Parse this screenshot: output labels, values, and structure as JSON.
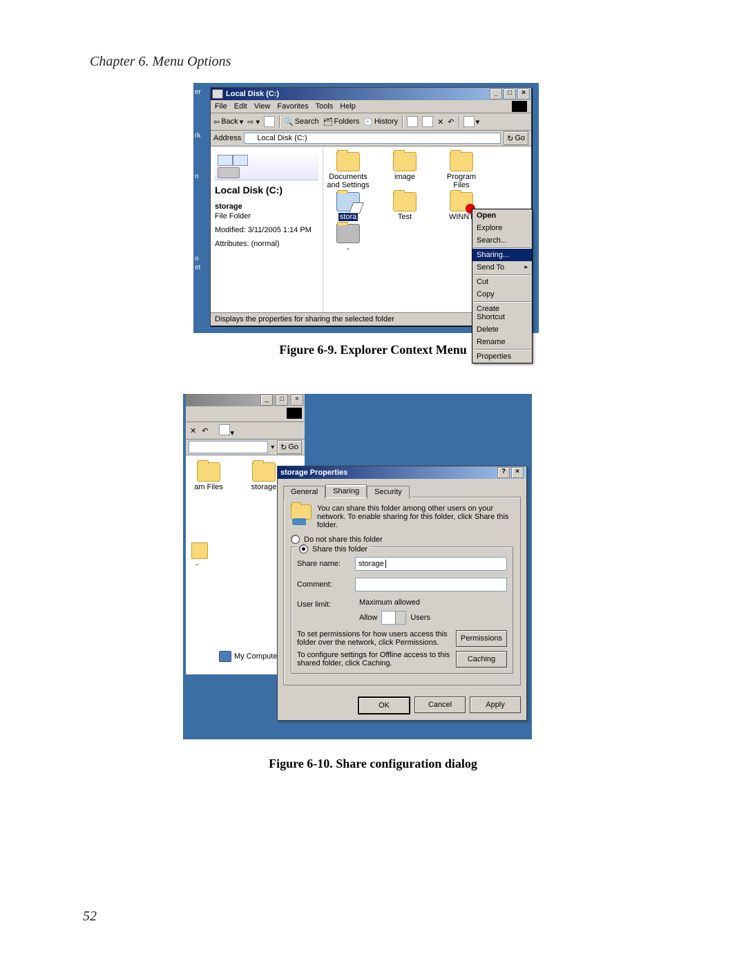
{
  "page": {
    "chapter_heading": "Chapter 6. Menu Options",
    "caption1": "Figure 6-9. Explorer Context Menu",
    "caption2": "Figure 6-10. Share configuration dialog",
    "page_number": "52"
  },
  "fig1": {
    "edge_labels": [
      "er",
      "rk",
      "n",
      "o",
      "et"
    ],
    "title": "Local Disk (C:)",
    "menus": [
      "File",
      "Edit",
      "View",
      "Favorites",
      "Tools",
      "Help"
    ],
    "toolbar": {
      "back": "Back",
      "search": "Search",
      "folders": "Folders",
      "history": "History"
    },
    "address_label": "Address",
    "address_value": "Local Disk (C:)",
    "go": "Go",
    "leftpane": {
      "location": "Local Disk (C:)",
      "sel_name": "storage",
      "sel_type": "File Folder",
      "modified": "Modified: 3/11/2005 1:14 PM",
      "attributes": "Attributes: (normal)"
    },
    "icons": [
      {
        "label": "Documents and Settings"
      },
      {
        "label": "image"
      },
      {
        "label": "Program Files"
      },
      {
        "label": "stora",
        "selected": true
      },
      {
        "label": "Test"
      },
      {
        "label": "WINNT",
        "winnt": true
      },
      {
        "label": "-"
      }
    ],
    "context": {
      "open": "Open",
      "explore": "Explore",
      "search": "Search...",
      "sharing": "Sharing...",
      "sendto": "Send To",
      "cut": "Cut",
      "copy": "Copy",
      "shortcut": "Create Shortcut",
      "delete": "Delete",
      "rename": "Rename",
      "properties": "Properties"
    },
    "status": "Displays the properties for sharing the selected folder"
  },
  "fig2": {
    "back": {
      "go": "Go",
      "icons": [
        {
          "label": "am Files"
        },
        {
          "label": "storage"
        }
      ],
      "mycomputer": "My Computer"
    },
    "dialog": {
      "title": "storage Properties",
      "tabs": {
        "general": "General",
        "sharing": "Sharing",
        "security": "Security"
      },
      "intro": "You can share this folder among other users on your network.  To enable sharing for this folder, click Share this folder.",
      "radio_no": "Do not share this folder",
      "radio_yes": "Share this folder",
      "sharename_lbl": "Share name:",
      "sharename_val": "storage",
      "comment_lbl": "Comment:",
      "userlimit_lbl": "User limit:",
      "ul_max": "Maximum allowed",
      "ul_allow": "Allow",
      "ul_users": "Users",
      "perm_text": "To set permissions for how users access this folder over the network, click Permissions.",
      "perm_btn": "Permissions",
      "cache_text": "To configure settings for Offline access to this shared folder, click Caching.",
      "cache_btn": "Caching",
      "ok": "OK",
      "cancel": "Cancel",
      "apply": "Apply"
    }
  }
}
